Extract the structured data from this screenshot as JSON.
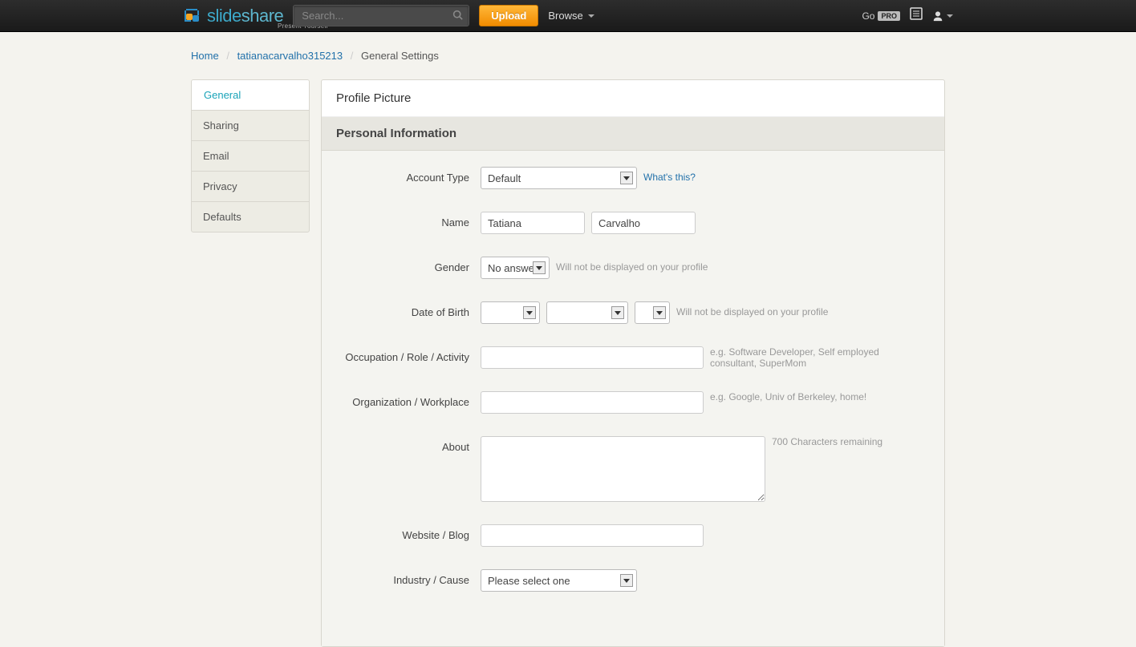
{
  "nav": {
    "logo_text_1": "slide",
    "logo_text_2": "share",
    "logo_tag": "Present Yourself",
    "search_placeholder": "Search...",
    "upload_label": "Upload",
    "browse_label": "Browse",
    "gopro_label": "Go",
    "pro_badge": "PRO"
  },
  "breadcrumb": {
    "home": "Home",
    "user": "tatianacarvalho315213",
    "current": "General Settings"
  },
  "sidebar": {
    "items": [
      "General",
      "Sharing",
      "Email",
      "Privacy",
      "Defaults"
    ],
    "active_index": 0
  },
  "sections": {
    "profile_picture": "Profile Picture",
    "personal_info": "Personal Information"
  },
  "form": {
    "account_type": {
      "label": "Account Type",
      "value": "Default",
      "help": "What's this?"
    },
    "name": {
      "label": "Name",
      "first": "Tatiana",
      "last": "Carvalho"
    },
    "gender": {
      "label": "Gender",
      "value": "No answer",
      "hint": "Will not be displayed on your profile"
    },
    "dob": {
      "label": "Date of Birth",
      "month": "",
      "day": "",
      "year": "",
      "hint": "Will not be displayed on your profile"
    },
    "occupation": {
      "label": "Occupation / Role / Activity",
      "value": "",
      "hint": "e.g. Software Developer, Self employed consultant, SuperMom"
    },
    "organization": {
      "label": "Organization / Workplace",
      "value": "",
      "hint": "e.g. Google, Univ of Berkeley, home!"
    },
    "about": {
      "label": "About",
      "value": "",
      "hint": "700 Characters remaining"
    },
    "website": {
      "label": "Website / Blog",
      "value": ""
    },
    "industry": {
      "label": "Industry / Cause",
      "value": "Please select one"
    }
  }
}
